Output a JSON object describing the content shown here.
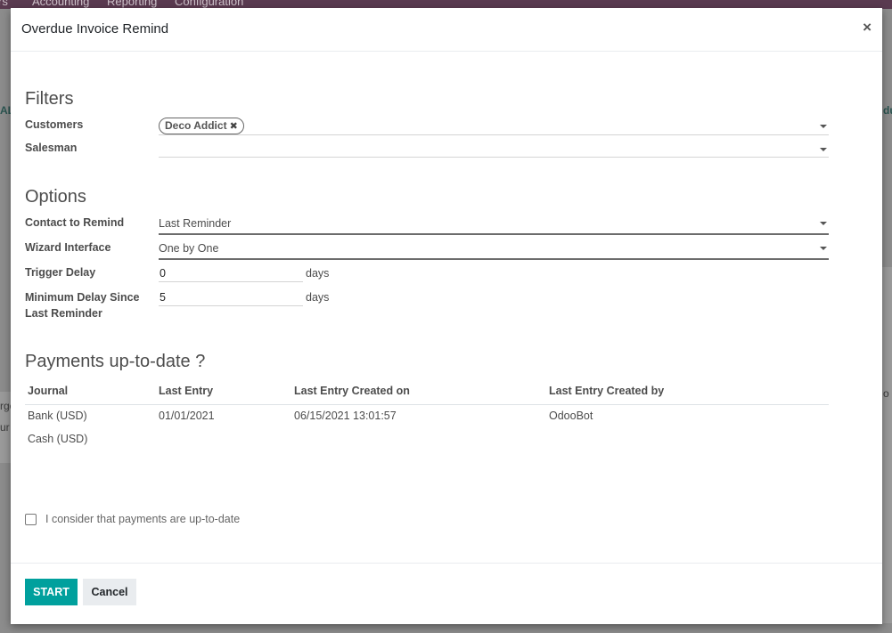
{
  "background": {
    "menu_items": [
      "rs",
      "Accounting",
      "Reporting",
      "Configuration"
    ],
    "edge_left_top": "AL",
    "edge_left_mid1": "rge",
    "edge_left_mid2": "ur",
    "edge_right_top": "du",
    "edge_right_mid": "o"
  },
  "modal": {
    "title": "Overdue Invoice Remind",
    "close_glyph": "×"
  },
  "filters": {
    "section_title": "Filters",
    "customers_label": "Customers",
    "customers_tags": [
      "Deco Addict"
    ],
    "tag_remove_glyph": "✖",
    "salesman_label": "Salesman",
    "salesman_value": ""
  },
  "options": {
    "section_title": "Options",
    "contact_label": "Contact to Remind",
    "contact_value": "Last Reminder",
    "wizard_label": "Wizard Interface",
    "wizard_value": "One by One",
    "trigger_label": "Trigger Delay",
    "trigger_value": "0",
    "trigger_unit": "days",
    "min_delay_label": "Minimum Delay Since Last Reminder",
    "min_delay_value": "5",
    "min_delay_unit": "days"
  },
  "payments": {
    "section_title": "Payments up-to-date ?",
    "columns": [
      "Journal",
      "Last Entry",
      "Last Entry Created on",
      "Last Entry Created by"
    ],
    "rows": [
      [
        "Bank (USD)",
        "01/01/2021",
        "06/15/2021 13:01:57",
        "OdooBot"
      ],
      [
        "Cash (USD)",
        "",
        "",
        ""
      ]
    ],
    "confirm_label": "I consider that payments are up-to-date",
    "confirm_checked": false
  },
  "footer": {
    "start_label": "START",
    "cancel_label": "Cancel"
  },
  "colors": {
    "primary": "#00a09d",
    "topbar": "#5a3a50"
  }
}
